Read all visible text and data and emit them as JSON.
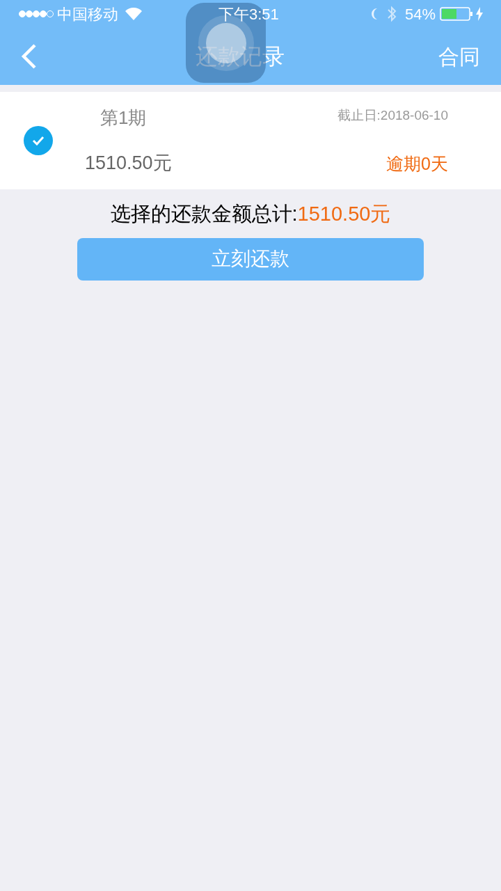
{
  "status_bar": {
    "carrier": "中国移动",
    "time": "下午3:51",
    "battery": "54%"
  },
  "nav": {
    "title": "还款记录",
    "action": "合同"
  },
  "installments": [
    {
      "period": "第1期",
      "due_date": "截止日:2018-06-10",
      "amount": "1510.50元",
      "overdue": "逾期0天",
      "checked": true
    }
  ],
  "summary": {
    "label": "选择的还款金额总计:",
    "amount": "1510.50元"
  },
  "pay_button": "立刻还款"
}
